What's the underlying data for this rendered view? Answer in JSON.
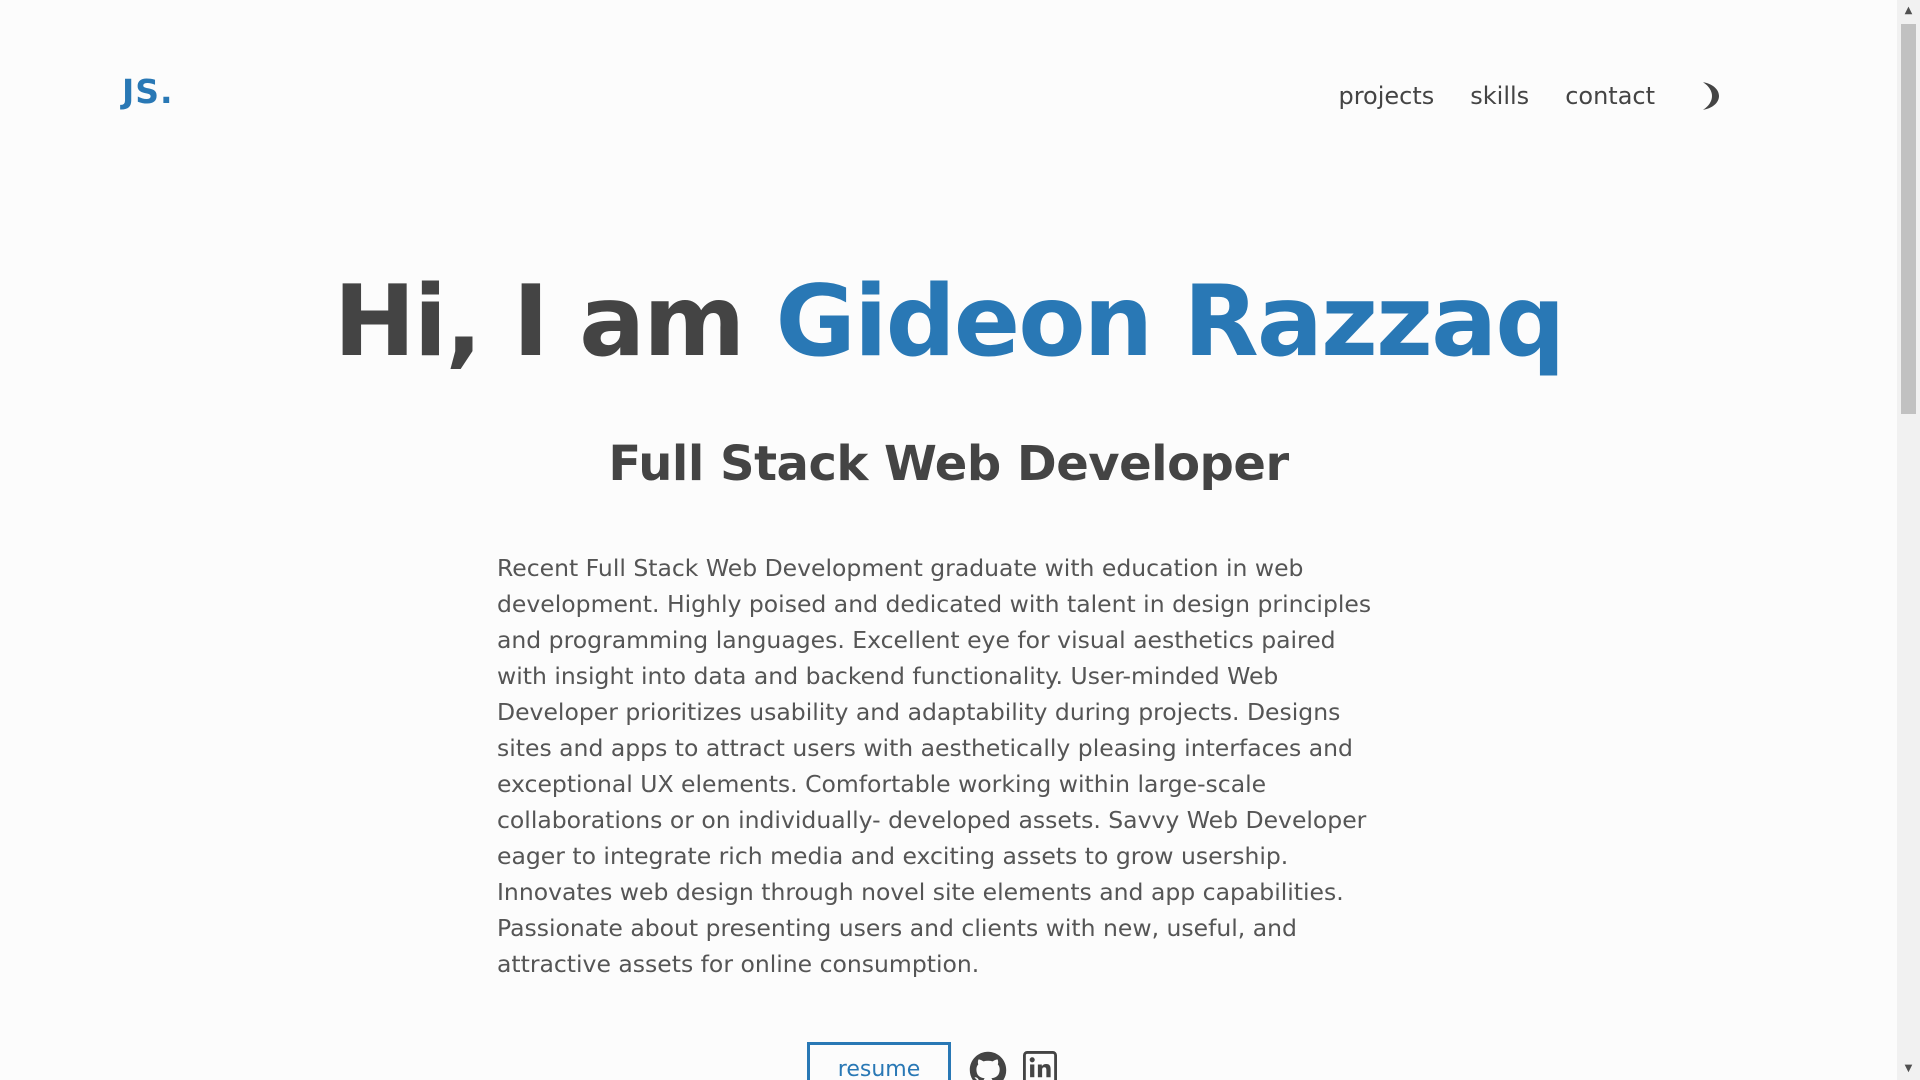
{
  "header": {
    "logo": "JS.",
    "nav": {
      "projects": "projects",
      "skills": "skills",
      "contact": "contact"
    },
    "theme_toggle_icon": "moon-icon"
  },
  "hero": {
    "greeting": "Hi, I am ",
    "name": "Gideon Razzaq",
    "subtitle": "Full Stack Web Developer",
    "about": "Recent Full Stack Web Development graduate with education in web development. Highly poised and dedicated with talent in design principles and programming languages. Excellent eye for visual aesthetics paired with insight into data and backend functionality. User-minded Web Developer prioritizes usability and adaptability during projects. Designs sites and apps to attract users with aesthetically pleasing interfaces and exceptional UX elements. Comfortable working within large-scale collaborations or on individually- developed assets. Savvy Web Developer eager to integrate rich media and exciting assets to grow usership. Innovates web design through novel site elements and app capabilities. Passionate about presenting users and clients with new, useful, and attractive assets for online consumption.",
    "resume_label": "resume",
    "github_icon": "github-icon",
    "linkedin_icon": "linkedin-icon"
  },
  "colors": {
    "accent": "#2978b5",
    "text": "#444444",
    "background": "#fcfcfc"
  }
}
